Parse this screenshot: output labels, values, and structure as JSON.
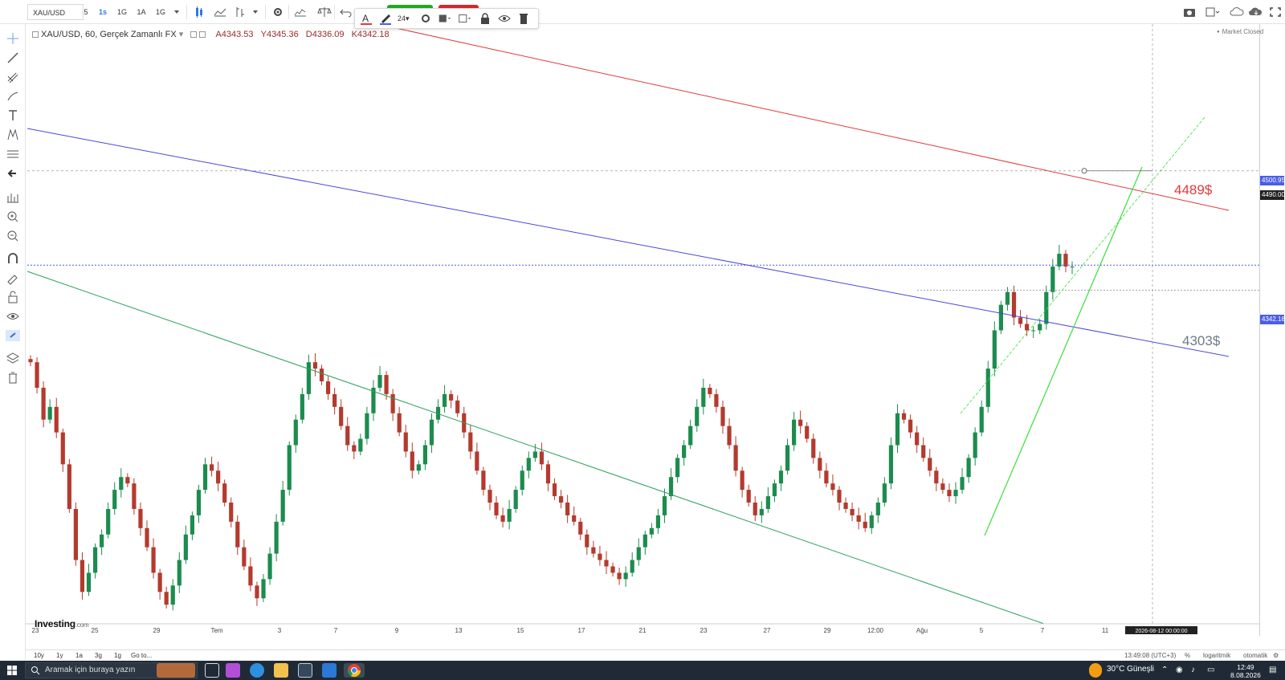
{
  "toolbar": {
    "symbol": "XAU/USD",
    "intervals": [
      "5",
      "1s",
      "1G",
      "1A",
      "1G"
    ],
    "active_interval": "1s",
    "draw_font_size": "24"
  },
  "legend": {
    "title": "XAU/USD, 60, Gerçek Zamanlı FX",
    "open": "A4343.53",
    "high": "Y4345.36",
    "low": "D4336.09",
    "close": "K4342.18"
  },
  "market_status": "Market Closed",
  "logo": {
    "main": "Investing",
    "suffix": ".com"
  },
  "colors": {
    "red_channel": "#e0393c",
    "blue_trend": "#4a47d9",
    "green_line": "#2aa05a",
    "light_green": "#39e03a",
    "bull": "#1c8c4e",
    "bear": "#b43a2e",
    "price_line": "#4a5ee8"
  },
  "annotations": {
    "target_high": "4489$",
    "target_low": "4303$"
  },
  "price_tags": {
    "upper": "4500.95",
    "target": "4490.00",
    "last": "4342.18"
  },
  "chart_data": {
    "type": "candlestick",
    "series_name": "XAU/USD",
    "ylim": [
      3780,
      4720
    ],
    "y_ticks": [
      4700,
      4680,
      4660,
      4640,
      4620,
      4600,
      4580,
      4560,
      4540,
      4520,
      4500,
      4480,
      4460,
      4440,
      4420,
      4400,
      4380,
      4360,
      4340,
      4320,
      4300,
      4280,
      4260,
      4240,
      4220,
      4200,
      4180,
      4160,
      4140,
      4120,
      4100,
      4080,
      4060,
      4040,
      4020,
      4000,
      3980,
      3960,
      3940,
      3920,
      3900,
      3880,
      3860,
      3840,
      3820,
      3800
    ],
    "x_labels": [
      "23",
      "25",
      "29",
      "Tem",
      "3",
      "7",
      "9",
      "13",
      "15",
      "17",
      "21",
      "23",
      "27",
      "29",
      "12:00",
      "Ağu",
      "5",
      "7",
      "11"
    ],
    "x_cursor_label": "2026-08-12 00:00:00",
    "crosshair_price": "4490.00",
    "closes": [
      4190,
      4150,
      4100,
      4120,
      4080,
      4030,
      3960,
      3880,
      3830,
      3860,
      3900,
      3920,
      3960,
      3990,
      4010,
      4000,
      3960,
      3930,
      3900,
      3860,
      3830,
      3810,
      3840,
      3880,
      3920,
      3950,
      3990,
      4030,
      4020,
      4000,
      3970,
      3940,
      3900,
      3870,
      3840,
      3820,
      3850,
      3890,
      3940,
      3990,
      4060,
      4100,
      4140,
      4190,
      4180,
      4160,
      4140,
      4120,
      4090,
      4060,
      4050,
      4070,
      4110,
      4150,
      4170,
      4140,
      4110,
      4080,
      4050,
      4020,
      4030,
      4060,
      4100,
      4120,
      4140,
      4130,
      4110,
      4080,
      4050,
      4020,
      3990,
      3970,
      3950,
      3940,
      3960,
      3990,
      4020,
      4040,
      4050,
      4030,
      4000,
      3980,
      3970,
      3950,
      3940,
      3920,
      3900,
      3890,
      3880,
      3870,
      3860,
      3850,
      3860,
      3880,
      3900,
      3920,
      3930,
      3950,
      3980,
      4010,
      4040,
      4060,
      4090,
      4120,
      4150,
      4140,
      4120,
      4090,
      4060,
      4020,
      3990,
      3970,
      3950,
      3960,
      3980,
      4000,
      4020,
      4060,
      4100,
      4090,
      4070,
      4040,
      4020,
      4000,
      3990,
      3970,
      3960,
      3950,
      3940,
      3930,
      3950,
      3970,
      4000,
      4060,
      4110,
      4100,
      4080,
      4060,
      4040,
      4020,
      4000,
      3990,
      3980,
      3990,
      4010,
      4040,
      4080,
      4120,
      4180,
      4240,
      4280,
      4300,
      4260,
      4250,
      4240,
      4240,
      4250,
      4300,
      4340,
      4360,
      4340,
      4340
    ],
    "annotation_levels": {
      "target_high": 4490,
      "target_low": 4303,
      "last": 4342.18
    }
  },
  "bottombar": {
    "ranges": [
      "10y",
      "1y",
      "1a",
      "3g",
      "1g",
      "Go to..."
    ],
    "utc_time": "13:49:08 (UTC+3)",
    "percent": "%",
    "log": "logaritmik",
    "auto": "otomatik"
  },
  "taskbar": {
    "search_placeholder": "Aramak için buraya yazın",
    "weather": "30°C  Güneşli",
    "time": "12:49",
    "date": "8.08.2026"
  }
}
